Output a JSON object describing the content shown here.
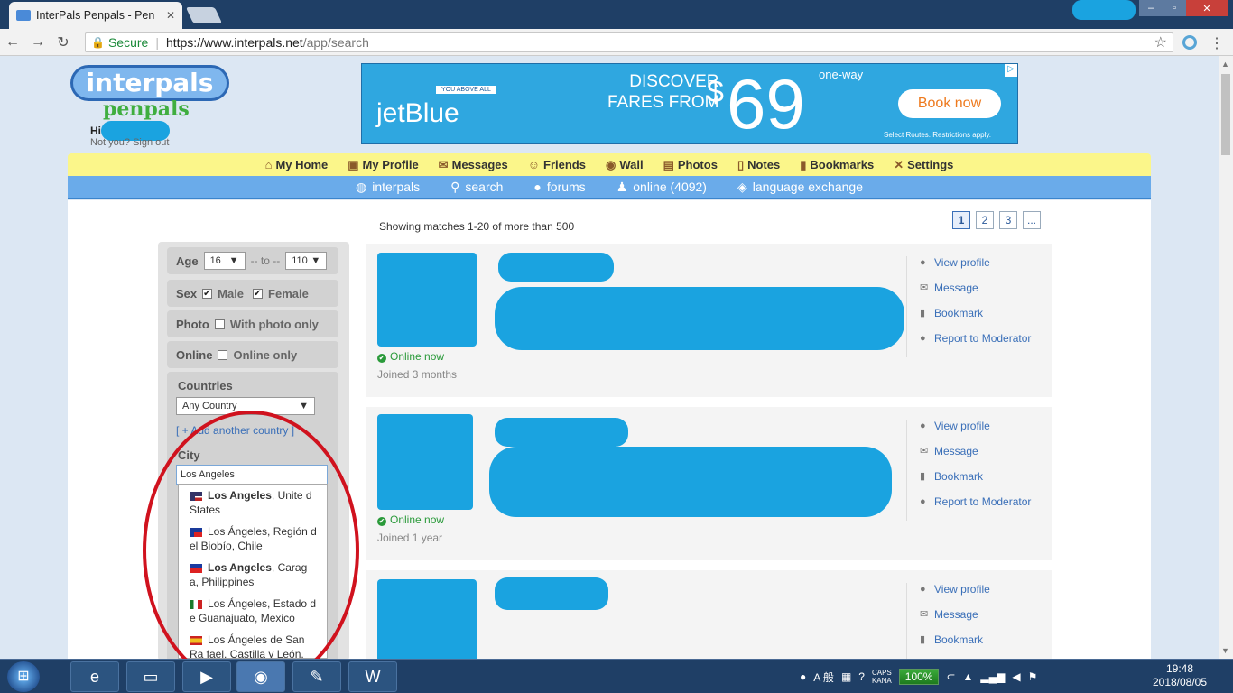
{
  "browser": {
    "tab_title": "InterPals Penpals - Pen",
    "secure_label": "Secure",
    "url_host": "https://www.interpals.net",
    "url_path": "/app/search"
  },
  "header": {
    "logo_main": "interpals",
    "logo_sub": "penpals",
    "greeting": "Hi",
    "not_you": "Not you? Sign out"
  },
  "ad": {
    "tagline": "YOU ABOVE ALL",
    "brand": "jetBlue",
    "line1": "DISCOVER",
    "line2": "FARES FROM",
    "dollar": "$",
    "price": "69",
    "one_way": "one-way",
    "cta": "Book now",
    "fine_print": "Select Routes. Restrictions apply.",
    "info": "▷"
  },
  "nav_primary": [
    {
      "label": "My Home",
      "icon": "⌂"
    },
    {
      "label": "My Profile",
      "icon": "▣"
    },
    {
      "label": "Messages",
      "icon": "✉"
    },
    {
      "label": "Friends",
      "icon": "☺"
    },
    {
      "label": "Wall",
      "icon": "◉"
    },
    {
      "label": "Photos",
      "icon": "▤"
    },
    {
      "label": "Notes",
      "icon": "▯"
    },
    {
      "label": "Bookmarks",
      "icon": "▮"
    },
    {
      "label": "Settings",
      "icon": "✕"
    }
  ],
  "nav_secondary": [
    {
      "label": "interpals",
      "icon": "◍"
    },
    {
      "label": "search",
      "icon": "⚲"
    },
    {
      "label": "forums",
      "icon": "●"
    },
    {
      "label": "online (4092)",
      "icon": "♟"
    },
    {
      "label": "language exchange",
      "icon": "◈"
    }
  ],
  "results": {
    "showing": "Showing matches 1-20 of more than 500",
    "pages": [
      "1",
      "2",
      "3",
      "..."
    ]
  },
  "filters": {
    "age_label": "Age",
    "age_from": "16",
    "age_sep": "-- to --",
    "age_to": "110",
    "sex_label": "Sex",
    "male": "Male",
    "female": "Female",
    "photo_label": "Photo",
    "photo_opt": "With photo only",
    "online_label": "Online",
    "online_opt": "Online only",
    "countries_label": "Countries",
    "country_value": "Any Country",
    "add_country": "[ + Add another country ]",
    "city_label": "City",
    "city_value": "Los Angeles"
  },
  "city_suggestions": [
    {
      "bold": "Los Angeles",
      "rest": ", Unite d States"
    },
    {
      "bold": "",
      "rest": "Los Ángeles, Región d el Biobío, Chile"
    },
    {
      "bold": "Los Angeles",
      "rest": ", Carag a, Philippines"
    },
    {
      "bold": "",
      "rest": "Los Ángeles, Estado d e Guanajuato, Mexico"
    },
    {
      "bold": "",
      "rest": "Los Ángeles de San Ra fael, Castilla y León, Spain"
    }
  ],
  "cards": [
    {
      "online": "Online now",
      "joined": "Joined 3 months"
    },
    {
      "online": "Online now",
      "joined": "Joined 1 year"
    },
    {
      "online": "",
      "joined": ""
    }
  ],
  "card_actions": {
    "view": "View profile",
    "message": "Message",
    "bookmark": "Bookmark",
    "report": "Report to Moderator"
  },
  "taskbar": {
    "battery": "100%",
    "caps": "CAPS",
    "kana": "KANA",
    "ime": "A 般",
    "time": "19:48",
    "date": "2018/08/05"
  },
  "colors": {
    "accent_blue": "#3a6fb8",
    "online_green": "#2a9a3a",
    "nav_yellow": "#fbf68a",
    "annotation_red": "#d0121e"
  }
}
